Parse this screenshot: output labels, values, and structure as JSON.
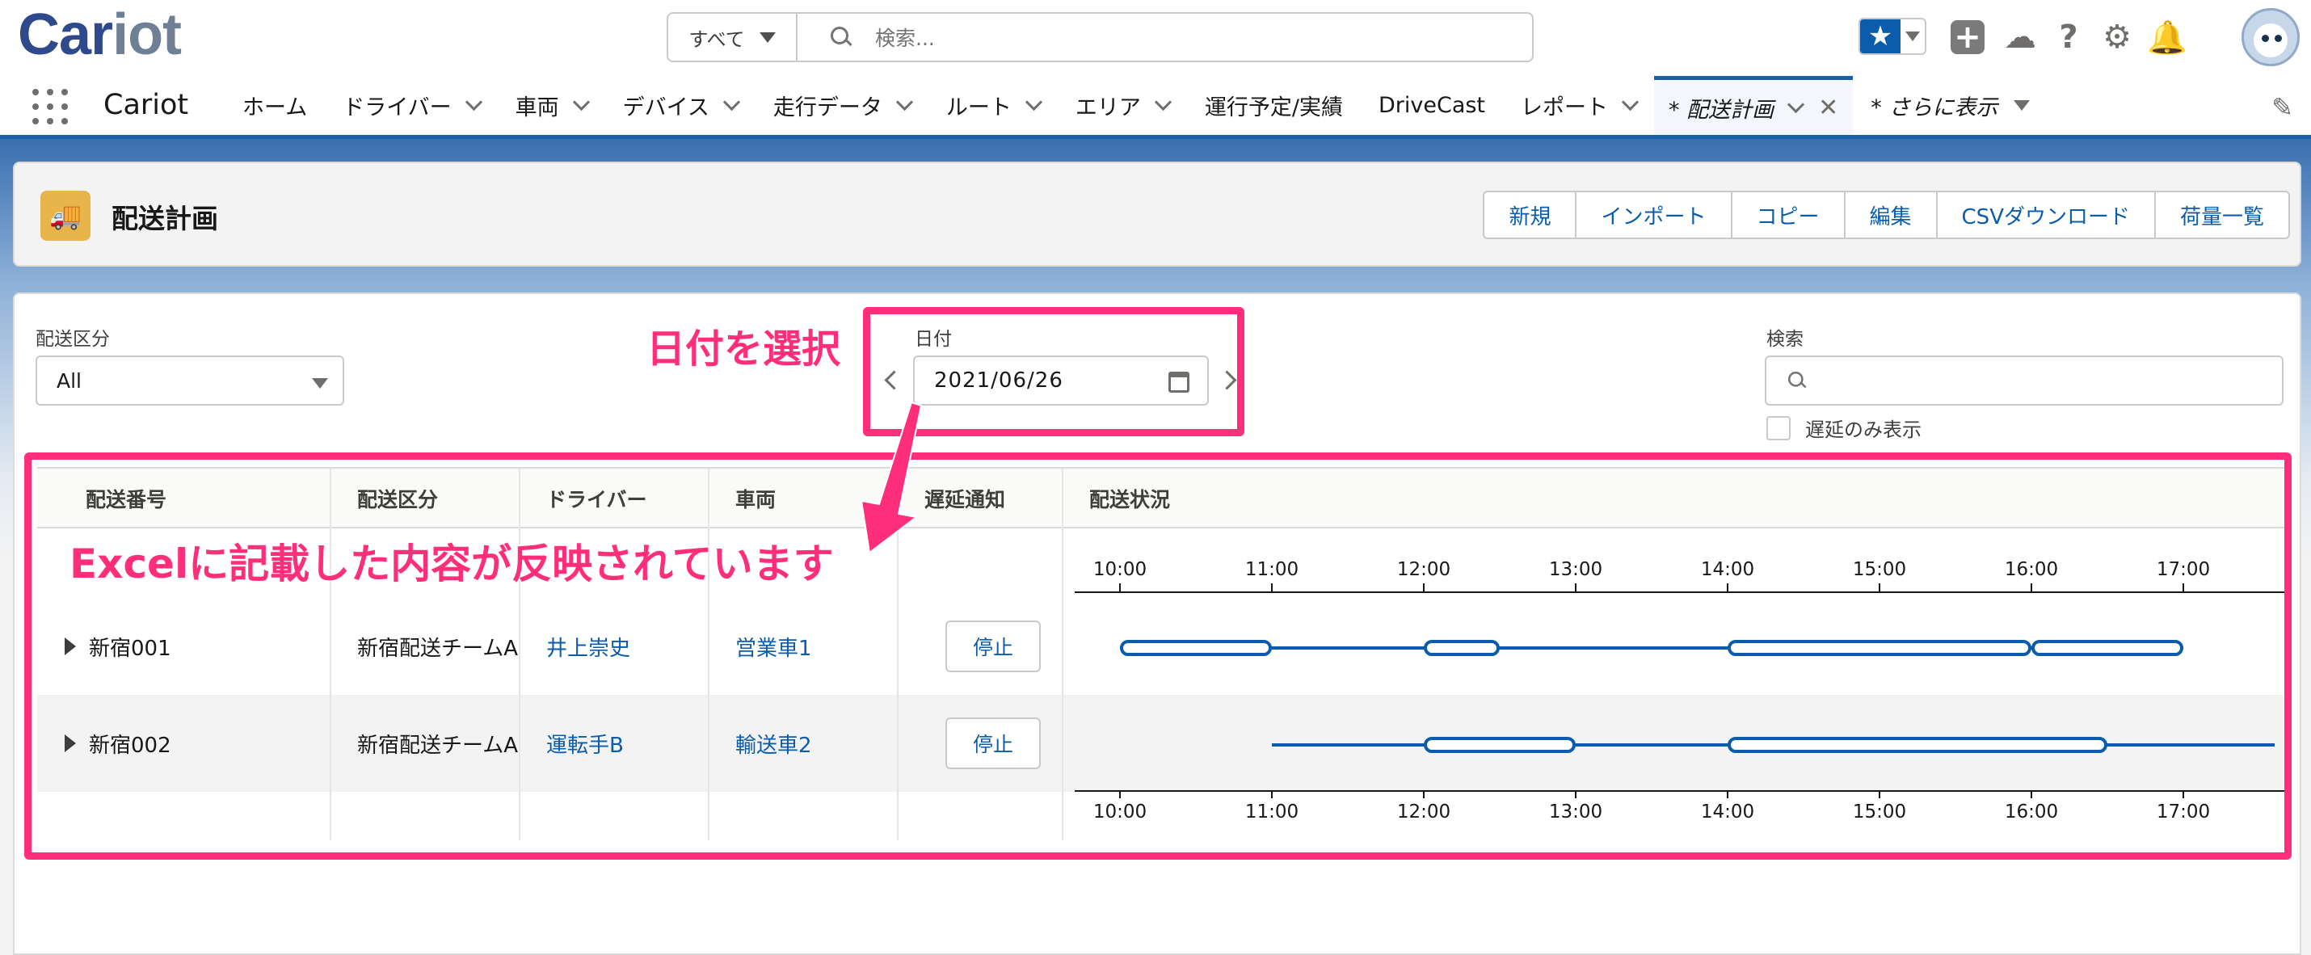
{
  "header": {
    "logo_text_a": "Car",
    "logo_text_b": "iot",
    "search_scope": "すべて",
    "search_placeholder": "検索..."
  },
  "nav": {
    "app_name": "Cariot",
    "items": [
      {
        "label": "ホーム"
      },
      {
        "label": "ドライバー"
      },
      {
        "label": "車両"
      },
      {
        "label": "デバイス"
      },
      {
        "label": "走行データ"
      },
      {
        "label": "ルート"
      },
      {
        "label": "エリア"
      },
      {
        "label": "運行予定/実績"
      },
      {
        "label": "DriveCast"
      },
      {
        "label": "レポート"
      }
    ],
    "active_tab": "* 配送計画",
    "more_tab": "* さらに表示"
  },
  "page": {
    "title": "配送計画",
    "buttons": [
      "新規",
      "インポート",
      "コピー",
      "編集",
      "CSVダウンロード",
      "荷量一覧"
    ]
  },
  "filters": {
    "category_label": "配送区分",
    "category_value": "All",
    "date_label": "日付",
    "date_value": "2021/06/26",
    "search_label": "検索",
    "delay_only_label": "遅延のみ表示"
  },
  "table": {
    "headers": [
      "配送番号",
      "配送区分",
      "ドライバー",
      "車両",
      "遅延通知",
      "配送状況"
    ],
    "rows": [
      {
        "number": "新宿001",
        "category": "新宿配送チームA",
        "driver": "井上崇史",
        "vehicle": "営業車1",
        "notify": "停止"
      },
      {
        "number": "新宿002",
        "category": "新宿配送チームA",
        "driver": "運転手B",
        "vehicle": "輸送車2",
        "notify": "停止"
      }
    ],
    "time_ticks": [
      "10:00",
      "11:00",
      "12:00",
      "13:00",
      "14:00",
      "15:00",
      "16:00",
      "17:00"
    ]
  },
  "timeline_data": {
    "rows": [
      {
        "lines": [
          [
            10.0,
            17.0
          ]
        ],
        "pills": [
          [
            10.0,
            11.0
          ],
          [
            12.0,
            12.5
          ],
          [
            14.0,
            16.0
          ],
          [
            16.0,
            17.0
          ]
        ]
      },
      {
        "lines": [
          [
            11.0,
            17.6
          ]
        ],
        "pills": [
          [
            12.0,
            13.0
          ],
          [
            14.0,
            16.5
          ]
        ]
      }
    ]
  },
  "annotations": {
    "select_date": "日付を選択",
    "excel_note": "Excelに記載した内容が反映されています"
  },
  "colors": {
    "brand_blue": "#0b5cab",
    "annotation_pink": "#ff2e7a",
    "page_icon": "#e8b54a"
  }
}
